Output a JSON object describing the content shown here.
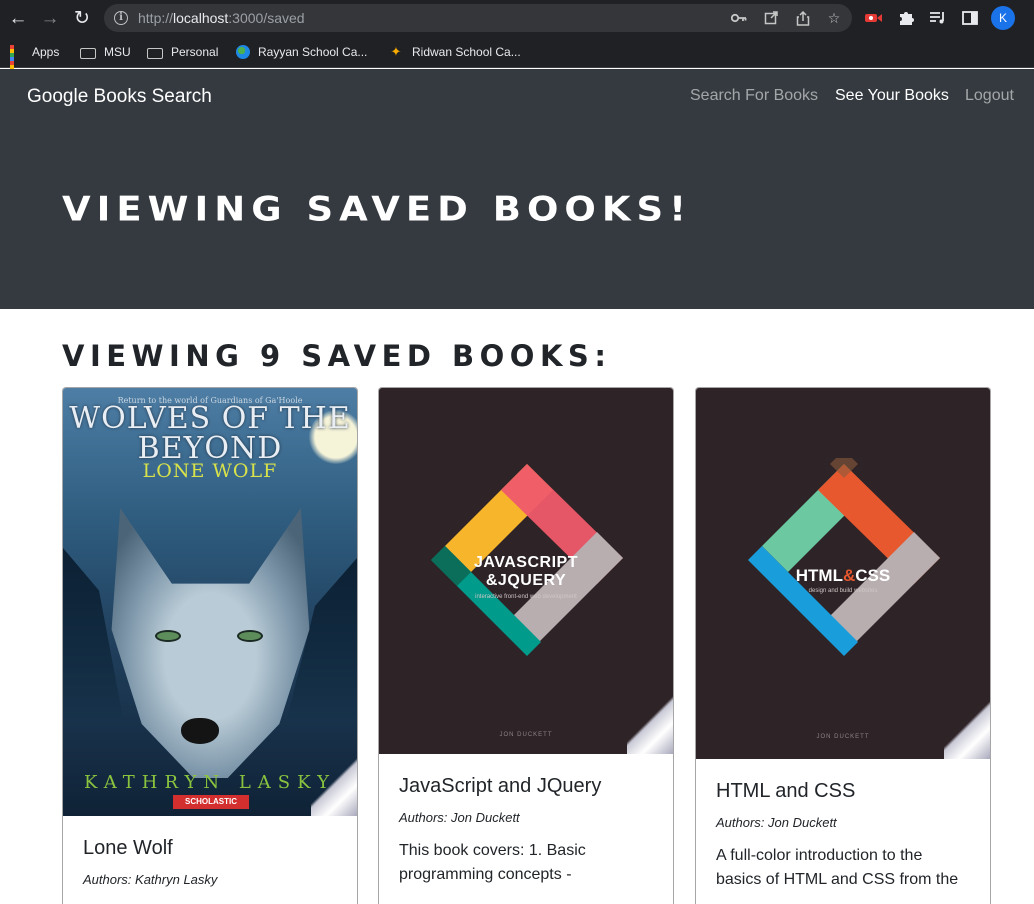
{
  "browser": {
    "url_scheme": "http://",
    "url_host": "localhost",
    "url_path": ":3000/saved",
    "profile_initial": "K",
    "bookmarks": [
      {
        "label": "Apps",
        "icon": "apps-grid-icon"
      },
      {
        "label": "MSU",
        "icon": "folder-icon"
      },
      {
        "label": "Personal",
        "icon": "folder-icon"
      },
      {
        "label": "Rayyan School Ca...",
        "icon": "globe-icon"
      },
      {
        "label": "Ridwan School Ca...",
        "icon": "figure-icon"
      }
    ]
  },
  "navbar": {
    "brand": "Google Books Search",
    "links": [
      {
        "label": "Search For Books",
        "active": false
      },
      {
        "label": "See Your Books",
        "active": true
      },
      {
        "label": "Logout",
        "active": false
      }
    ]
  },
  "jumbotron": {
    "title": "VIEWING SAVED BOOKS!"
  },
  "saved": {
    "heading": "VIEWING 9 SAVED BOOKS:",
    "books": [
      {
        "title": "Lone Wolf",
        "authors": "Authors: Kathryn Lasky",
        "description": "",
        "cover": {
          "series_line": "Return to the world of Guardians of Ga'Hoole",
          "title_line": "WOLVES OF THE BEYOND",
          "subtitle": "LONE WOLF",
          "author": "KATHRYN LASKY",
          "publisher": "SCHOLASTIC"
        }
      },
      {
        "title": "JavaScript and JQuery",
        "authors": "Authors: Jon Duckett",
        "description": "This book covers: 1. Basic programming concepts -",
        "cover": {
          "title_line1": "JAVASCRIPT",
          "title_line2": "&JQUERY",
          "subtitle": "interactive front-end web development",
          "author": "JON DUCKETT",
          "colors": [
            "#f7b52c",
            "#ef5a6a",
            "#b8aeb0",
            "#009b8a"
          ]
        }
      },
      {
        "title": "HTML and CSS",
        "authors": "Authors: Jon Duckett",
        "description": "A full-color introduction to the basics of HTML and CSS from the",
        "cover": {
          "title_part1": "HTML",
          "title_amp": "&",
          "title_part2": "CSS",
          "subtitle": "design and build websites",
          "author": "JON DUCKETT",
          "colors": [
            "#6cc8a0",
            "#e8582e",
            "#b8aeb0",
            "#1a9edb"
          ]
        }
      }
    ]
  },
  "colors": {
    "navbar_bg": "#343a40",
    "chrome_bg": "#202124",
    "duckett_cover_bg": "#2e2326"
  }
}
